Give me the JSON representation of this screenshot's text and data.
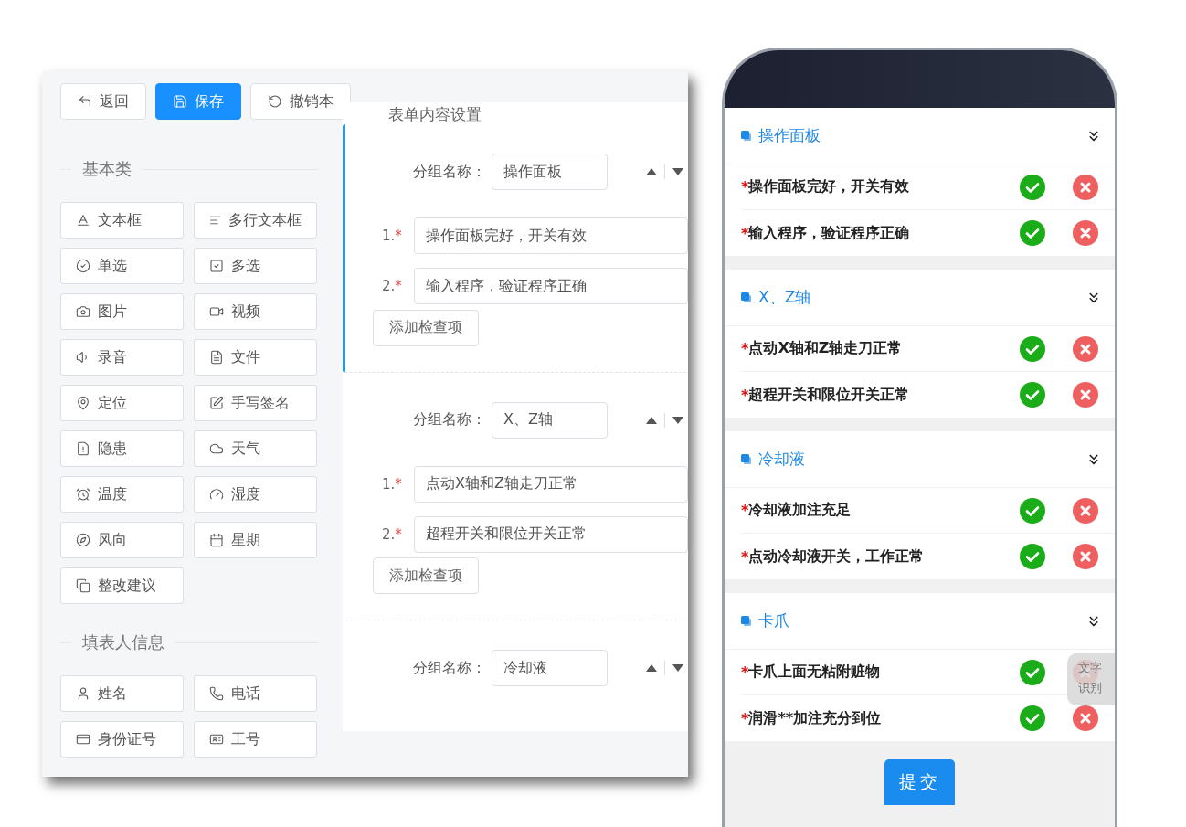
{
  "toolbar": [
    {
      "label": "返回",
      "kind": "back",
      "primary": false
    },
    {
      "label": "保存",
      "kind": "save",
      "primary": true
    },
    {
      "label": "撤销本",
      "kind": "undo",
      "primary": false
    }
  ],
  "palette": [
    {
      "title": "基本类",
      "items": [
        {
          "label": "文本框",
          "kind": "text"
        },
        {
          "label": "多行文本框",
          "kind": "textarea"
        },
        {
          "label": "单选",
          "kind": "radio"
        },
        {
          "label": "多选",
          "kind": "checkbox"
        },
        {
          "label": "图片",
          "kind": "image"
        },
        {
          "label": "视频",
          "kind": "video"
        },
        {
          "label": "录音",
          "kind": "audio"
        },
        {
          "label": "文件",
          "kind": "file"
        },
        {
          "label": "定位",
          "kind": "location"
        },
        {
          "label": "手写签名",
          "kind": "signature"
        },
        {
          "label": "隐患",
          "kind": "hazard"
        },
        {
          "label": "天气",
          "kind": "weather"
        },
        {
          "label": "温度",
          "kind": "temperature"
        },
        {
          "label": "湿度",
          "kind": "humidity"
        },
        {
          "label": "风向",
          "kind": "wind"
        },
        {
          "label": "星期",
          "kind": "weekday"
        },
        {
          "label": "整改建议",
          "kind": "suggestion"
        }
      ]
    },
    {
      "title": "填表人信息",
      "items": [
        {
          "label": "姓名",
          "kind": "person"
        },
        {
          "label": "电话",
          "kind": "phone"
        },
        {
          "label": "身份证号",
          "kind": "card"
        },
        {
          "label": "工号",
          "kind": "badge"
        }
      ]
    }
  ],
  "form": {
    "title": "表单内容设置",
    "groups": [
      {
        "name_label": "分组名称：",
        "name": "操作面板",
        "selected": true,
        "items": [
          {
            "number": "1.",
            "mark": "*",
            "value": "操作面板完好，开关有效"
          },
          {
            "number": "2.",
            "mark": "*",
            "value": "输入程序，验证程序正确"
          }
        ],
        "add_label": "添加检查项"
      },
      {
        "name_label": "分组名称：",
        "name": "X、Z轴",
        "selected": false,
        "items": [
          {
            "number": "1.",
            "mark": "*",
            "value": "点动X轴和Z轴走刀正常"
          },
          {
            "number": "2.",
            "mark": "*",
            "value": "超程开关和限位开关正常"
          }
        ],
        "add_label": "添加检查项"
      },
      {
        "name_label": "分组名称：",
        "name": "冷却液",
        "selected": false
      }
    ]
  },
  "preview": {
    "sections": [
      {
        "title": "操作面板",
        "items": [
          {
            "mark": "*",
            "text": "操作面板完好，开关有效"
          },
          {
            "mark": "*",
            "text": "输入程序，验证程序正确"
          }
        ]
      },
      {
        "title": "X、Z轴",
        "items": [
          {
            "mark": "*",
            "text": "点动X轴和Z轴走刀正常"
          },
          {
            "mark": "*",
            "text": "超程开关和限位开关正常"
          }
        ]
      },
      {
        "title": "冷却液",
        "items": [
          {
            "mark": "*",
            "text": "冷却液加注充足"
          },
          {
            "mark": "*",
            "text": "点动冷却液开关，工作正常"
          }
        ]
      },
      {
        "title": "卡爪",
        "items": [
          {
            "mark": "*",
            "text": "卡爪上面无粘附赃物"
          },
          {
            "mark": "*",
            "text": "润滑**加注充分到位"
          }
        ]
      }
    ],
    "float_button": "文字识别",
    "submit": "提交"
  }
}
